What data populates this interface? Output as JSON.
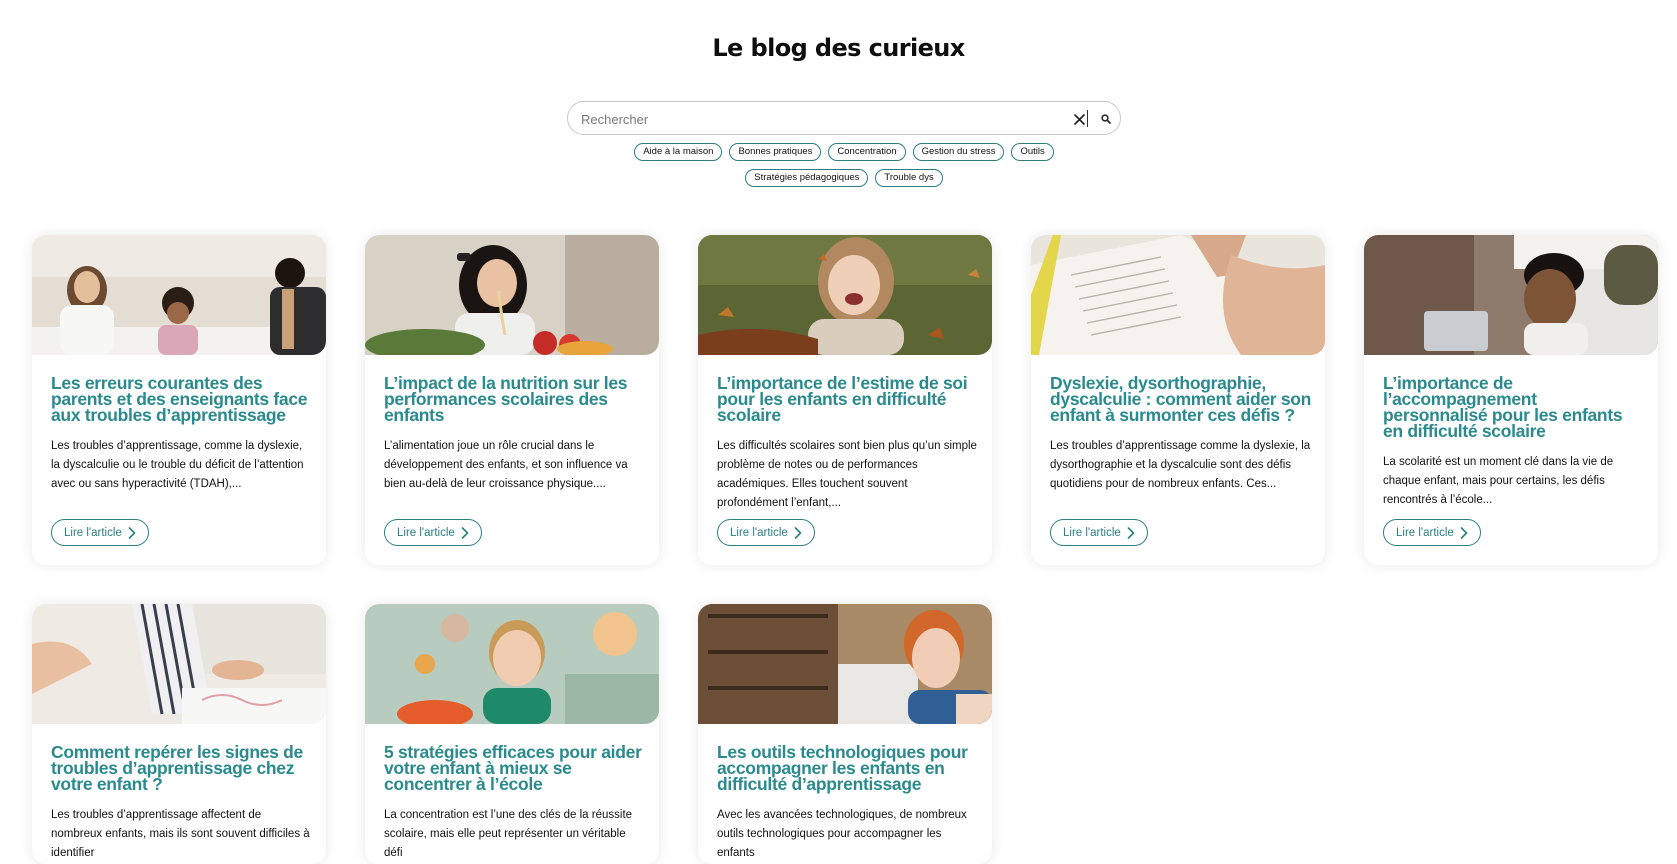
{
  "header": {
    "title": "Le blog des curieux"
  },
  "search": {
    "placeholder": "Rechercher",
    "value": ""
  },
  "tags": {
    "row1": [
      "Aide à la maison",
      "Bonnes pratiques",
      "Concentration",
      "Gestion du stress",
      "Outils"
    ],
    "row2": [
      "Stratégies pédagogiques",
      "Trouble dys"
    ]
  },
  "colors": {
    "accent": "#2a8a8e",
    "tag_border": "#2c7d82",
    "text": "#111111",
    "background": "#ffffff"
  },
  "icons": {
    "clear": "close-icon",
    "search": "search-icon",
    "button_arrow": "chevron-right-icon"
  },
  "cards": [
    {
      "title": "Les erreurs courantes des parents et des enseignants face aux troubles d’apprentissage",
      "excerpt": "Les troubles d’apprentissage, comme la dyslexie, la dyscalculie ou le trouble du déficit de l’attention avec ou sans hyperactivité (TDAH),...",
      "button": "Lire l'article"
    },
    {
      "title": "L’impact de la nutrition sur les performances scolaires des enfants",
      "excerpt": "L’alimentation joue un rôle crucial dans le développement des enfants, et son influence va bien au-delà de leur croissance physique....",
      "button": "Lire l'article"
    },
    {
      "title": "L’importance de l’estime de soi pour les enfants en difficulté scolaire",
      "excerpt": "Les difficultés scolaires sont bien plus qu’un simple problème de notes ou de performances académiques. Elles touchent souvent profondément l’enfant,...",
      "button": "Lire l'article"
    },
    {
      "title": "Dyslexie, dysorthographie, dyscalculie : comment aider son enfant à surmonter ces défis ?",
      "excerpt": "Les troubles d’apprentissage comme la dyslexie, la dysorthographie et la dyscalculie sont des défis quotidiens pour de nombreux enfants. Ces...",
      "button": "Lire l'article"
    },
    {
      "title": "L’importance de l’accompagnement personnalisé pour les enfants en difficulté scolaire",
      "excerpt": "La scolarité est un moment clé dans la vie de chaque enfant, mais pour certains, les défis rencontrés à l’école...",
      "button": "Lire l'article"
    },
    {
      "title": "Comment repérer les signes de troubles d’apprentissage chez votre enfant ?",
      "excerpt": "Les troubles d’apprentissage affectent de nombreux enfants, mais ils sont souvent difficiles à identifier",
      "button": ""
    },
    {
      "title": "5 stratégies efficaces pour aider votre enfant à mieux se concentrer à l’école",
      "excerpt": "La concentration est l’une des clés de la réussite scolaire, mais elle peut représenter un véritable défi",
      "button": ""
    },
    {
      "title": "Les outils technologiques pour accompagner les enfants en difficulté d’apprentissage",
      "excerpt": "Avec les avancées technologiques, de nombreux outils technologiques pour accompagner les enfants",
      "button": ""
    }
  ]
}
